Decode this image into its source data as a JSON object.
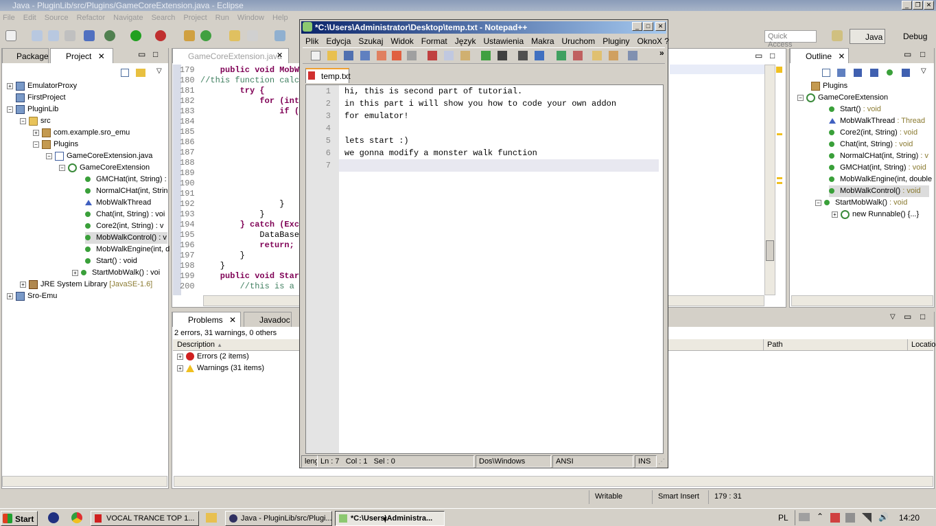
{
  "eclipse": {
    "title": "Java - PluginLib/src/Plugins/GameCoreExtension.java - Eclipse",
    "menu": [
      "File",
      "Edit",
      "Source",
      "Refactor",
      "Navigate",
      "Search",
      "Project",
      "Run",
      "Window",
      "Help"
    ],
    "quick_access_placeholder": "Quick Access",
    "perspectives": {
      "java": "Java",
      "debug": "Debug"
    },
    "left_tabs": {
      "package": "Package",
      "project": "Project"
    },
    "project_tree": [
      {
        "label": "EmulatorProxy"
      },
      {
        "label": "FirstProject"
      },
      {
        "label": "PluginLib"
      },
      {
        "label": "src"
      },
      {
        "label": "com.example.sro_emu"
      },
      {
        "label": "Plugins"
      },
      {
        "label": "GameCoreExtension.java"
      },
      {
        "label": "GameCoreExtension"
      },
      {
        "label": "GMCHat(int, String) :"
      },
      {
        "label": "NormalCHat(int, Strin"
      },
      {
        "label": "MobWalkThread"
      },
      {
        "label": "Chat(int, String) : voi"
      },
      {
        "label": "Core2(int, String) : v"
      },
      {
        "label": "MobWalkControl() : v"
      },
      {
        "label": "MobWalkEngine(int, d"
      },
      {
        "label": "Start() : void"
      },
      {
        "label": "StartMobWalk() : voi"
      },
      {
        "label": "JRE System Library",
        "suffix": "[JavaSE-1.6]"
      },
      {
        "label": "Sro-Emu"
      }
    ],
    "editor_tab": "GameCoreExtension.java",
    "code_lines": [
      {
        "n": "179",
        "text": "    public void MobW"
      },
      {
        "n": "180",
        "text": "//this function calc"
      },
      {
        "n": "181",
        "text": "        try {"
      },
      {
        "n": "182",
        "text": "            for (int"
      },
      {
        "n": "183",
        "text": "                if ("
      },
      {
        "n": "184",
        "text": ""
      },
      {
        "n": "185",
        "text": ""
      },
      {
        "n": "186",
        "text": ""
      },
      {
        "n": "187",
        "text": ""
      },
      {
        "n": "188",
        "text": ""
      },
      {
        "n": "189",
        "text": ""
      },
      {
        "n": "190",
        "text": ""
      },
      {
        "n": "191",
        "text": ""
      },
      {
        "n": "192",
        "text": "                }"
      },
      {
        "n": "193",
        "text": "            }"
      },
      {
        "n": "194",
        "text": "        } catch (Exc"
      },
      {
        "n": "195",
        "text": "            DataBase"
      },
      {
        "n": "196",
        "text": "            return;"
      },
      {
        "n": "197",
        "text": "        }"
      },
      {
        "n": "198",
        "text": "    }"
      },
      {
        "n": "199",
        "text": "    public void Star"
      },
      {
        "n": "200",
        "text": "        //this is a"
      }
    ],
    "outline_tab": "Outline",
    "outline_tree": [
      {
        "label": "Plugins",
        "suffix": ""
      },
      {
        "label": "GameCoreExtension",
        "suffix": ""
      },
      {
        "label": "Start()",
        "suffix": " : void"
      },
      {
        "label": "MobWalkThread",
        "suffix": " : Thread"
      },
      {
        "label": "Core2(int, String)",
        "suffix": " : void"
      },
      {
        "label": "Chat(int, String)",
        "suffix": " : void"
      },
      {
        "label": "NormalCHat(int, String)",
        "suffix": " : v"
      },
      {
        "label": "GMCHat(int, String)",
        "suffix": " : void"
      },
      {
        "label": "MobWalkEngine(int, double",
        "suffix": ""
      },
      {
        "label": "MobWalkControl()",
        "suffix": " : void"
      },
      {
        "label": "StartMobWalk()",
        "suffix": " : void"
      },
      {
        "label": "new Runnable() {...}",
        "suffix": ""
      }
    ],
    "bottom_tabs": {
      "problems": "Problems",
      "javadoc": "Javadoc"
    },
    "problems_summary": "2 errors, 31 warnings, 0 others",
    "problems_columns": {
      "description": "Description",
      "path": "Path",
      "location": "Locatio"
    },
    "problems_rows": [
      "Errors (2 items)",
      "Warnings (31 items)"
    ],
    "status": {
      "writable": "Writable",
      "insert": "Smart Insert",
      "position": "179 : 31"
    }
  },
  "npp": {
    "title": "*C:\\Users\\Administrator\\Desktop\\temp.txt - Notepad++",
    "menu": [
      "Plik",
      "Edycja",
      "Szukaj",
      "Widok",
      "Format",
      "Język",
      "Ustawienia",
      "Makra",
      "Uruchom",
      "Pluginy",
      "Okno",
      "?"
    ],
    "close_x": "X",
    "tab": "temp.txt",
    "lines": [
      {
        "n": "1",
        "text": "hi, this is second part of tutorial."
      },
      {
        "n": "2",
        "text": "in this part i will show you how to code your own addon"
      },
      {
        "n": "3",
        "text": "for emulator!"
      },
      {
        "n": "4",
        "text": ""
      },
      {
        "n": "5",
        "text": "lets start :)"
      },
      {
        "n": "6",
        "text": "we gonna modify a monster walk function"
      },
      {
        "n": "7",
        "text": ""
      }
    ],
    "status": {
      "length": "leng",
      "ln": "Ln : 7",
      "col": "Col : 1",
      "sel": "Sel : 0",
      "eol": "Dos\\Windows",
      "encoding": "ANSI",
      "mode": "INS"
    }
  },
  "taskbar": {
    "start": "Start",
    "buttons": [
      "VOCAL TRANCE TOP 1...",
      "Java - PluginLib/src/Plugi...",
      "*C:\\Users\\Administra..."
    ],
    "lang": "PL",
    "clock": "14:20"
  }
}
